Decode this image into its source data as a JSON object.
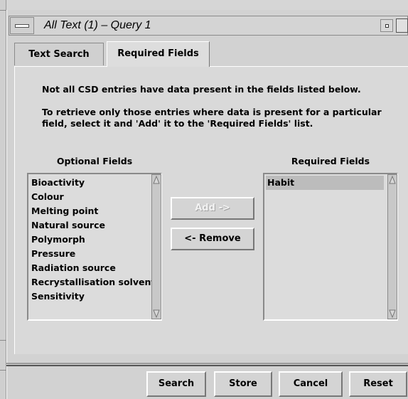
{
  "window": {
    "title": "All Text (1) – Query 1"
  },
  "tabs": [
    {
      "label": "Text Search",
      "active": false
    },
    {
      "label": "Required Fields",
      "active": true
    }
  ],
  "message": {
    "line1": "Not all CSD entries have data present in the fields listed below.",
    "line2": "To retrieve only those entries where data is present for a particular",
    "line3": "field, select it and 'Add' it to the 'Required Fields' list."
  },
  "optional": {
    "header": "Optional Fields",
    "items": [
      "Bioactivity",
      "Colour",
      "Melting point",
      "Natural source",
      "Polymorph",
      "Pressure",
      "Radiation source",
      "Recrystallisation solvent",
      "Sensitivity"
    ]
  },
  "required": {
    "header": "Required Fields",
    "items": [
      "Habit"
    ],
    "selected": "Habit"
  },
  "transfer": {
    "add_label": "Add ->",
    "add_enabled": false,
    "remove_label": "<- Remove"
  },
  "actions": {
    "search_label": "Search",
    "store_label": "Store",
    "cancel_label": "Cancel",
    "reset_label": "Reset"
  },
  "colors": {
    "background": "#d6d6d6",
    "selection": "#bcbcbc"
  }
}
